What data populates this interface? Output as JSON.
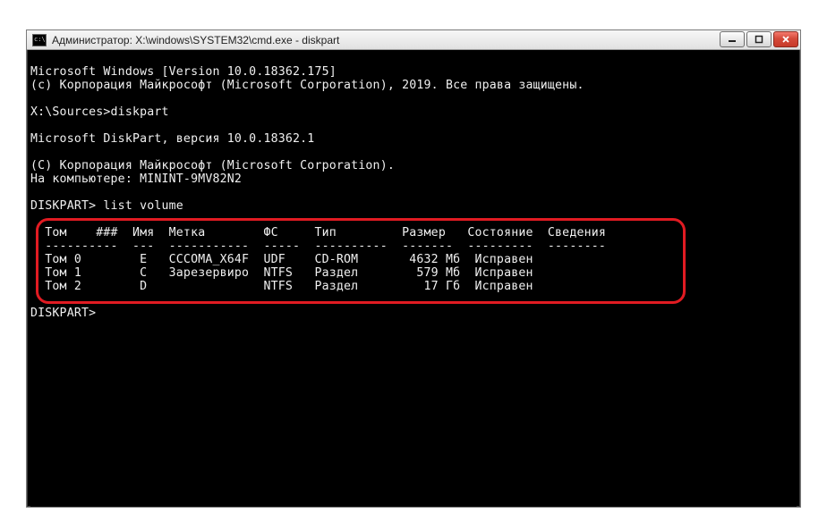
{
  "window": {
    "title": "Администратор: X:\\windows\\SYSTEM32\\cmd.exe - diskpart"
  },
  "output": {
    "line01": "Microsoft Windows [Version 10.0.18362.175]",
    "line02": "(c) Корпорация Майкрософт (Microsoft Corporation), 2019. Все права защищены.",
    "blank1": "",
    "prompt1": "X:\\Sources>diskpart",
    "blank2": "",
    "line03": "Microsoft DiskPart, версия 10.0.18362.1",
    "blank3": "",
    "line04": "(C) Корпорация Майкрософт (Microsoft Corporation).",
    "line05": "На компьютере: MININT-9MV82N2",
    "blank4": "",
    "prompt2": "DISKPART> list volume",
    "blank5": "",
    "header": "  Том    ###  Имя  Метка        ФС     Тип         Размер   Состояние  Сведения",
    "divider": "  ----------  ---  -----------  -----  ----------  -------  ---------  --------",
    "row0": "  Том 0        E   CCCOMA_X64F  UDF    CD-ROM       4632 Мб  Исправен",
    "row1": "  Том 1        C   Зарезервиро  NTFS   Раздел        579 Мб  Исправен",
    "row2": "  Том 2        D                NTFS   Раздел         17 Гб  Исправен",
    "blank6": "",
    "prompt3": "DISKPART>"
  },
  "table": {
    "columns": [
      "Том",
      "###",
      "Имя",
      "Метка",
      "ФС",
      "Тип",
      "Размер",
      "Состояние",
      "Сведения"
    ],
    "rows": [
      {
        "tom": "Том 0",
        "num": "",
        "name": "E",
        "label": "CCCOMA_X64F",
        "fs": "UDF",
        "type": "CD-ROM",
        "size": "4632 Мб",
        "status": "Исправен",
        "info": ""
      },
      {
        "tom": "Том 1",
        "num": "",
        "name": "C",
        "label": "Зарезервиро",
        "fs": "NTFS",
        "type": "Раздел",
        "size": "579 Мб",
        "status": "Исправен",
        "info": ""
      },
      {
        "tom": "Том 2",
        "num": "",
        "name": "D",
        "label": "",
        "fs": "NTFS",
        "type": "Раздел",
        "size": "17 Гб",
        "status": "Исправен",
        "info": ""
      }
    ]
  }
}
